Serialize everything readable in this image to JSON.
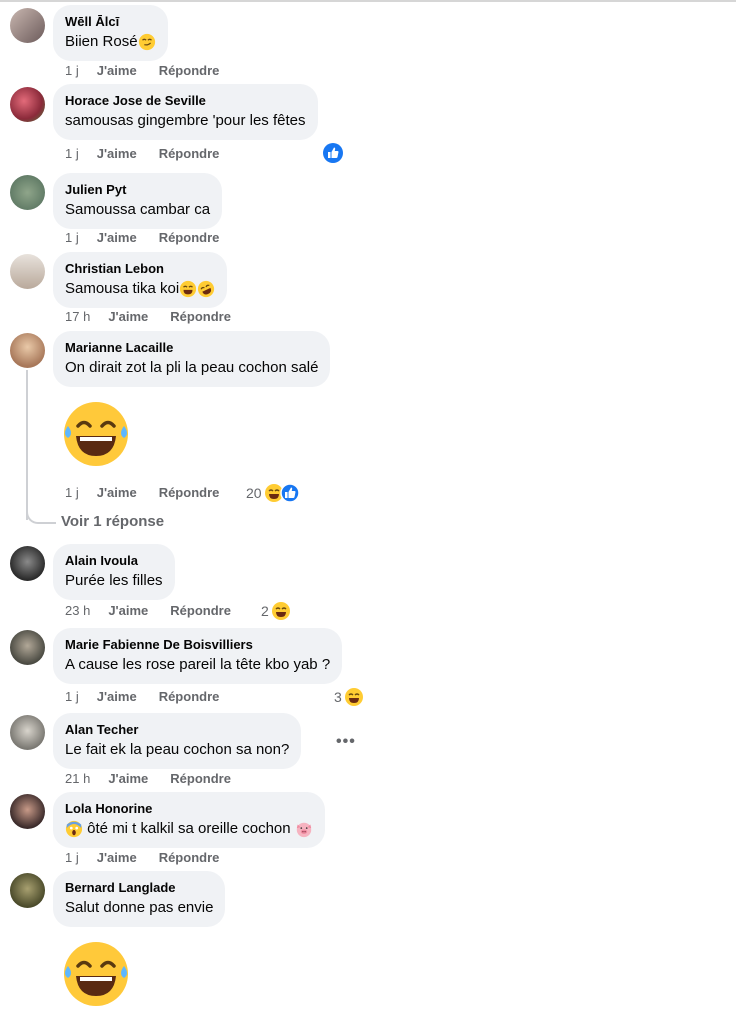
{
  "comments": [
    {
      "author": "Wēll Ālcī",
      "text": "Biien Rosé",
      "time": "1 j"
    },
    {
      "author": "Horace Jose de Seville",
      "text": "samousas gingembre 'pour les fêtes",
      "time": "1 j"
    },
    {
      "author": "Julien Pyt",
      "text": "Samoussa cambar ca",
      "time": "1 j"
    },
    {
      "author": "Christian Lebon",
      "text": "Samousa tika koi",
      "time": "17 h"
    },
    {
      "author": "Marianne Lacaille",
      "text": "On dirait zot la pli la peau cochon salé",
      "time": "1 j",
      "reaction_count": "20"
    },
    {
      "author": "Alain Ivoula",
      "text": "Purée les filles",
      "time": "23 h",
      "reaction_count": "2"
    },
    {
      "author": "Marie Fabienne De Boisvilliers",
      "text": "A cause les rose pareil la tête kbo yab ?",
      "time": "1 j",
      "reaction_count": "3"
    },
    {
      "author": "Alan Techer",
      "text": "Le fait ek la peau cochon sa non?",
      "time": "21 h"
    },
    {
      "author": "Lola Honorine",
      "text": "ôté mi t kalkil sa oreille cochon",
      "time": "1 j"
    },
    {
      "author": "Bernard Langlade",
      "text": "Salut donne pas envie"
    }
  ],
  "actions": {
    "like": "J'aime",
    "reply": "Répondre"
  },
  "view_replies": "Voir 1 réponse",
  "colors": {
    "bubble": "#f0f2f5",
    "meta": "#65676b",
    "like_blue": "#1877f2",
    "emoji_yellow": "#ffcc33"
  }
}
